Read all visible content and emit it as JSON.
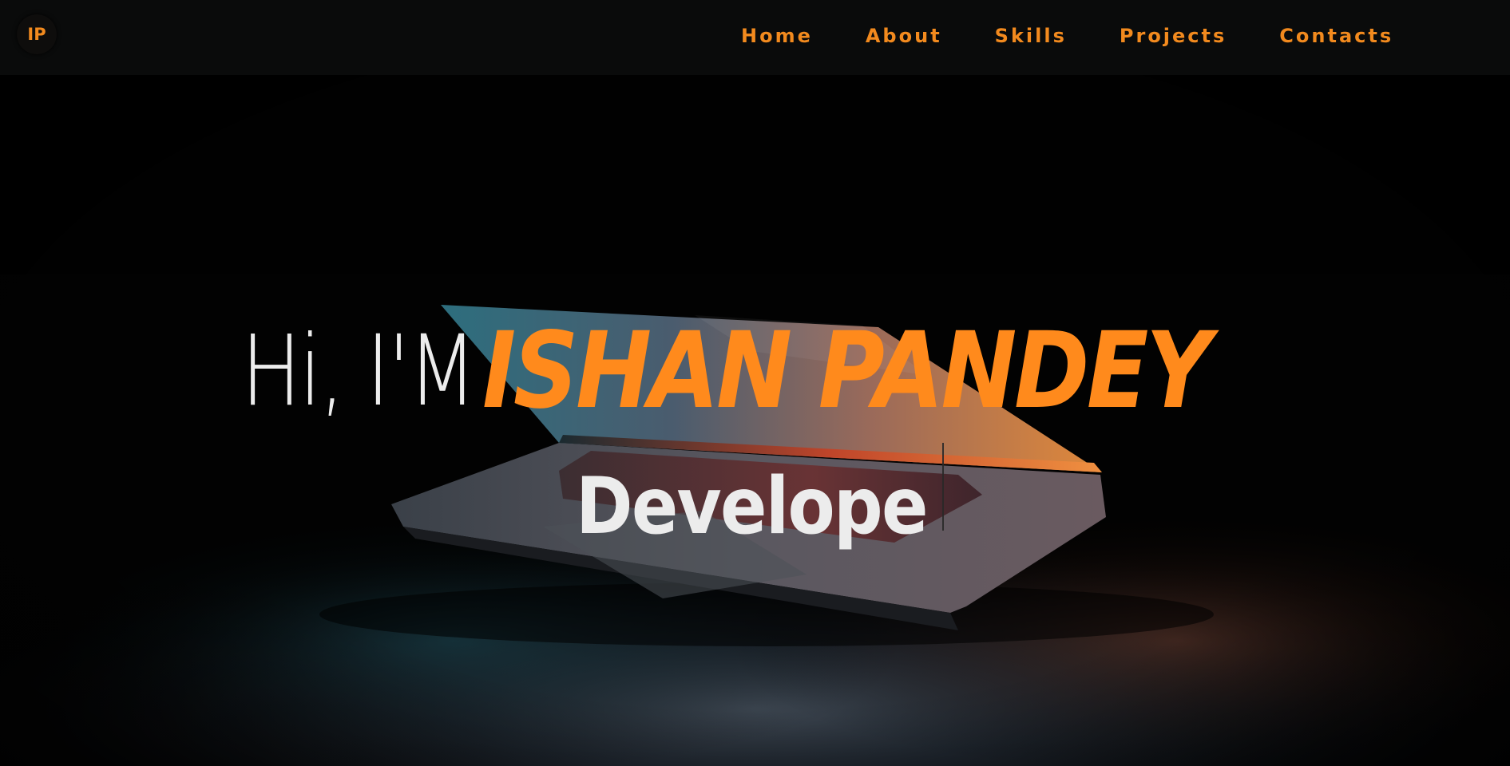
{
  "logo": {
    "text": "IP"
  },
  "nav": {
    "items": [
      {
        "label": "Home"
      },
      {
        "label": "About"
      },
      {
        "label": "Skills"
      },
      {
        "label": "Projects"
      },
      {
        "label": "Contacts"
      }
    ]
  },
  "hero": {
    "greeting": "Hi, I'M",
    "name": "ISHAN PANDEY",
    "role": "Develope"
  },
  "colors": {
    "accent": "#ff8a1c",
    "nav_text": "#f28a1e",
    "navbar_bg": "#0a0b0b",
    "hero_text": "#ececec",
    "background": "#030303"
  }
}
